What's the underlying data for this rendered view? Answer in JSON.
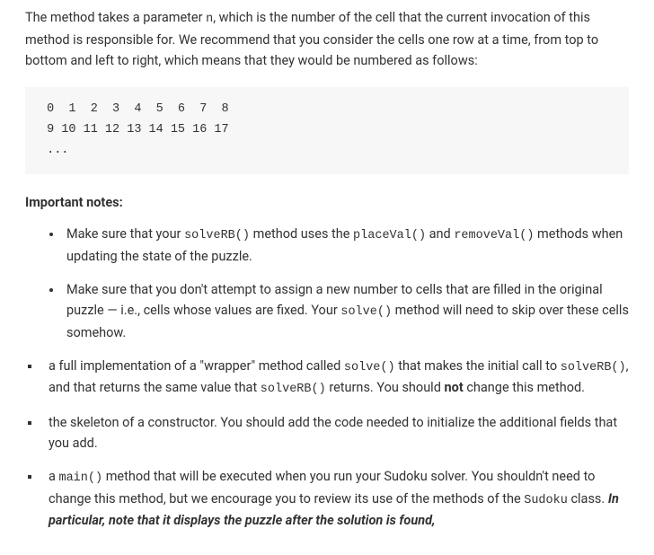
{
  "intro": {
    "p1a": "The method takes a parameter ",
    "p1b": ", which is the number of the cell that the current invocation of this method is responsible for. We recommend that you consider the cells one row at a time, from top to bottom and left to right, which means that they would be numbered as follows:",
    "code_n": "n"
  },
  "codeblock": " 0  1  2  3  4  5  6  7  8\n 9 10 11 12 13 14 15 16 17\n ...",
  "notes_heading": "Important notes:",
  "notes": {
    "n0_a": "Make sure that your ",
    "n0_b": " method uses the ",
    "n0_c": " and ",
    "n0_d": " methods when updating the state of the puzzle.",
    "n0_code1": "solveRB()",
    "n0_code2": "placeVal()",
    "n0_code3": "removeVal()",
    "n1_a": "Make sure that you don't attempt to assign a new number to cells that are filled in the original puzzle — i.e., cells whose values are fixed. Your ",
    "n1_b": " method will need to skip over these cells somehow.",
    "n1_code1": "solve()"
  },
  "outer": {
    "o0_a": "a full implementation of a \"wrapper\" method called ",
    "o0_b": " that makes the initial call to ",
    "o0_c": ", and that returns the same value that ",
    "o0_d": " returns. You should ",
    "o0_not": "not",
    "o0_e": " change this method.",
    "o0_code1": "solve()",
    "o0_code2": "solveRB()",
    "o0_code3": "solveRB()",
    "o1": "the skeleton of a constructor. You should add the code needed to initialize the additional fields that you add.",
    "o2_a": "a ",
    "o2_b": " method that will be executed when you run your Sudoku solver. You shouldn't need to change this method, but we encourage you to review its use of the methods of the ",
    "o2_c": " class. ",
    "o2_ital": "In particular, note that it displays the puzzle after the solution is found,",
    "o2_code1": "main()",
    "o2_code2": "Sudoku"
  }
}
